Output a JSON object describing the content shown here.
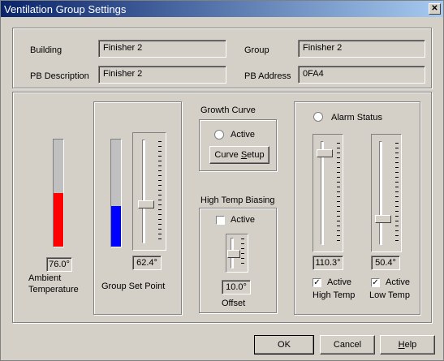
{
  "window": {
    "title": "Ventilation Group Settings",
    "close_glyph": "✕"
  },
  "info": {
    "building_label": "Building",
    "building_value": "Finisher 2",
    "pb_description_label": "PB Description",
    "pb_description_value": "Finisher 2",
    "group_label": "Group",
    "group_value": "Finisher 2",
    "pb_address_label": "PB Address",
    "pb_address_value": "0FA4"
  },
  "ambient": {
    "value": "76.0°",
    "label_line1": "Ambient",
    "label_line2": "Temperature",
    "fill_color": "#ff0000",
    "level": 0.5
  },
  "setpoint": {
    "value": "62.4°",
    "label": "Group Set Point",
    "fill_color": "#0000ff",
    "level": 0.38,
    "slider_level": 0.38
  },
  "growth_curve": {
    "title": "Growth Curve",
    "active_label": "Active",
    "button_pre": "Curve ",
    "button_u": "S",
    "button_post": "etup"
  },
  "high_temp_biasing": {
    "title": "High Temp Biasing",
    "active_label": "Active",
    "offset_value": "10.0°",
    "offset_label": "Offset",
    "slider_level": 0.5
  },
  "alarm": {
    "title": "Alarm Status",
    "high": {
      "value": "110.3°",
      "active_label": "Active",
      "label": "High Temp",
      "slider_level": 0.9,
      "checked": "✓"
    },
    "low": {
      "value": "50.4°",
      "active_label": "Active",
      "label": "Low Temp",
      "slider_level": 0.25,
      "checked": "✓"
    }
  },
  "buttons": {
    "ok": "OK",
    "cancel": "Cancel",
    "help_u": "H",
    "help_rest": "elp"
  }
}
